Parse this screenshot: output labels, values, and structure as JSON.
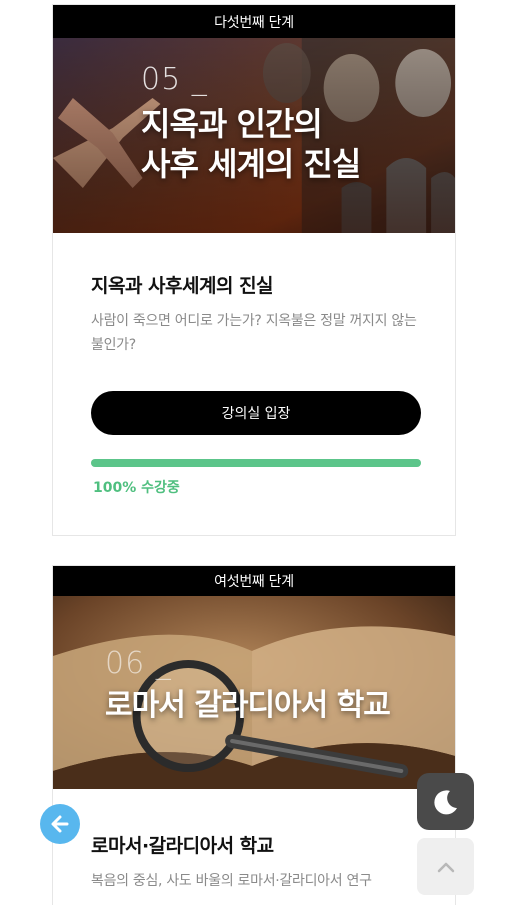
{
  "card1": {
    "stage_label": "다섯번째 단계",
    "banner_number": "05 _",
    "banner_line1": "지옥과 인간의",
    "banner_line2": "사후 세계의 진실",
    "title": "지옥과 사후세계의 진실",
    "description": "사람이 죽으면 어디로 가는가? 지옥불은 정말 꺼지지 않는 불인가?",
    "button_label": "강의실 입장",
    "progress_percent": 100,
    "progress_text": "100% 수강중"
  },
  "card2": {
    "stage_label": "여섯번째 단계",
    "banner_number": "06 _",
    "banner_title": "로마서 갈라디아서 학교",
    "title": "로마서·갈라디아서 학교",
    "description": "복음의 중심, 사도 바울의 로마서·갈라디아서 연구"
  },
  "floating": {
    "back_icon": "arrow-left-icon",
    "dark_mode_icon": "moon-icon",
    "scroll_top_icon": "chevron-up-icon"
  },
  "colors": {
    "progress": "#5cc58a",
    "back_button": "#58b7ee",
    "dark_button": "#4a4a4a"
  }
}
